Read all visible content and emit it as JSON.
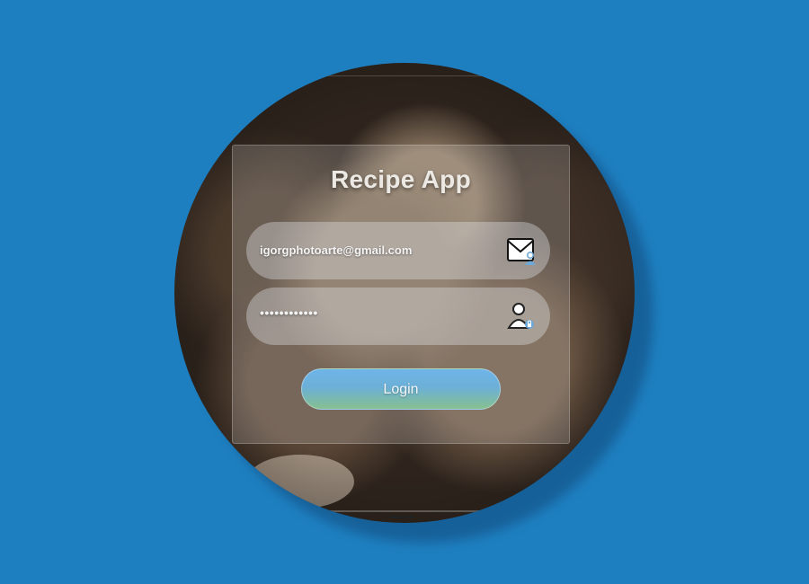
{
  "app": {
    "title": "Recipe App"
  },
  "form": {
    "email_value": "igorgphotoarte@gmail.com",
    "password_value": "••••••••••••",
    "login_label": "Login"
  },
  "icons": {
    "email": "envelope-person-icon",
    "password": "user-lock-icon"
  },
  "colors": {
    "background": "#1e7fc0",
    "button_top": "#6fb4e8",
    "button_bottom": "#86c08e"
  }
}
